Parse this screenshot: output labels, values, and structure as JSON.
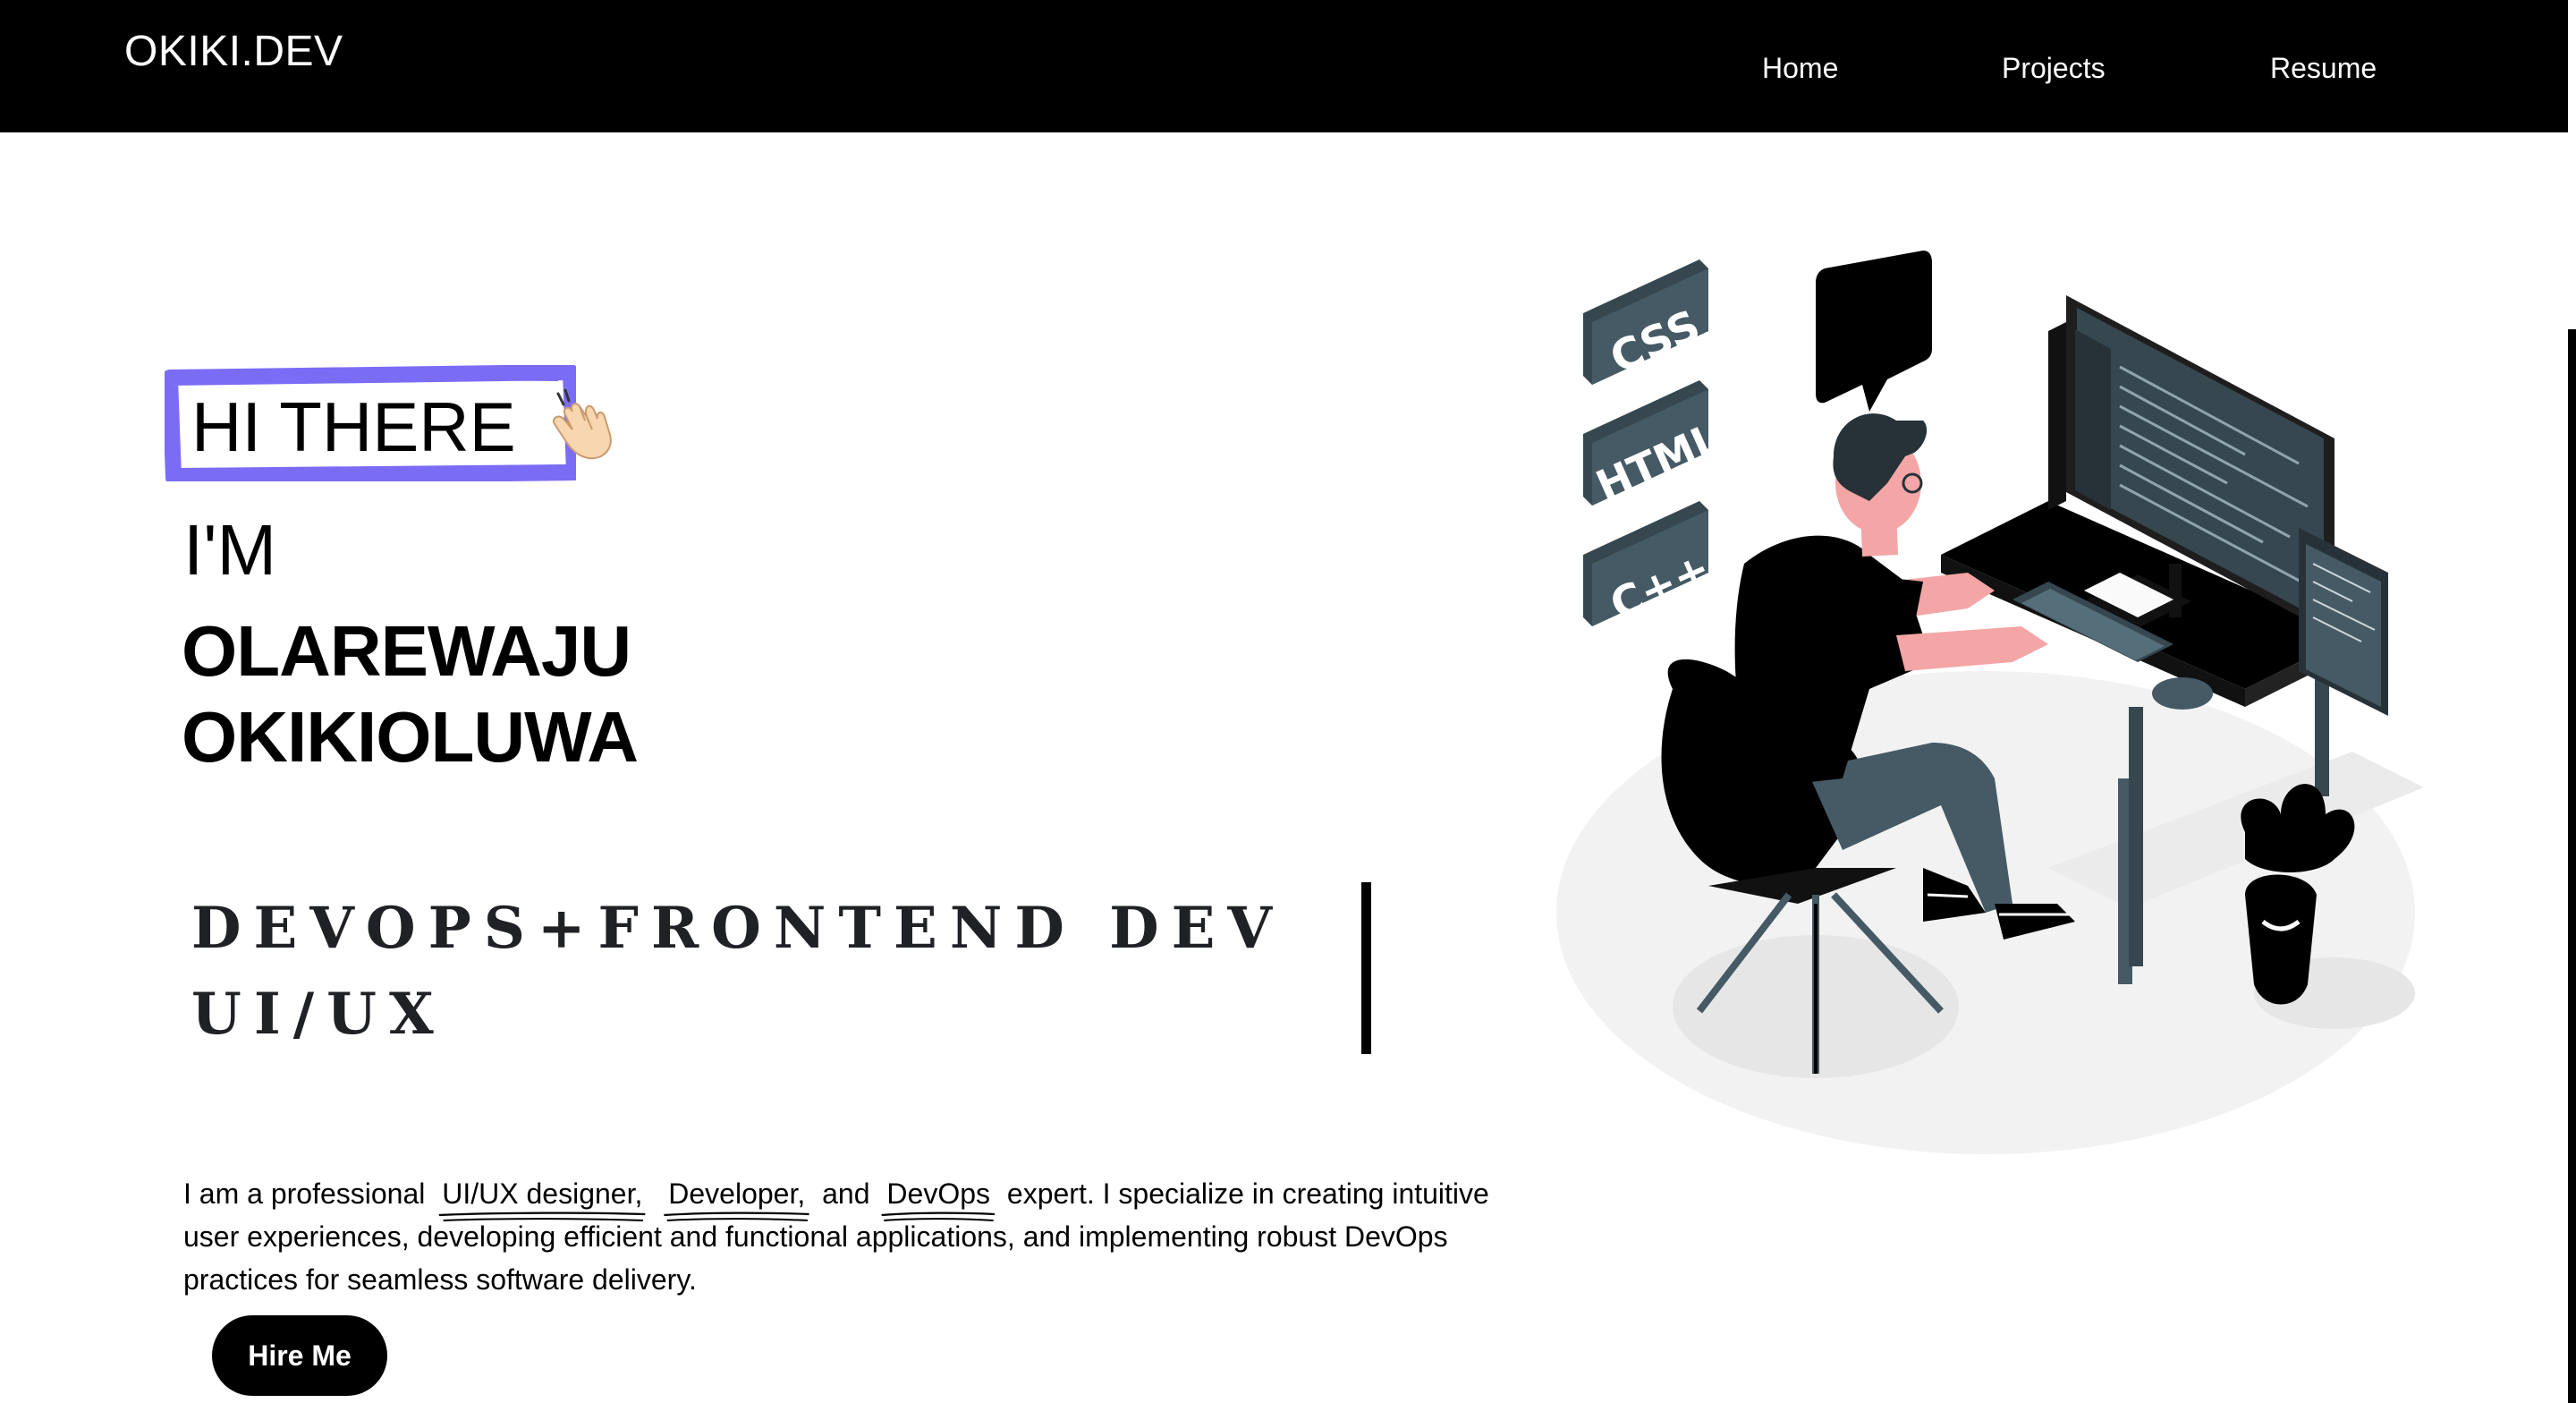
{
  "nav": {
    "brand": "OKIKI.DEV",
    "links": [
      {
        "label": "Home"
      },
      {
        "label": "Projects"
      },
      {
        "label": "Resume"
      }
    ]
  },
  "hero": {
    "greeting": "HI THERE",
    "greeting_icon": "waving-hand-icon",
    "im": "I'M",
    "name_line1": "OLAREWAJU",
    "name_line2": "OKIKIOLUWA",
    "roles": "DEVOPS+FRONTEND DEV\nUI/UX",
    "intro": {
      "prefix": "I am a professional",
      "highlight1": "UI/UX designer,",
      "highlight2": "Developer,",
      "and": "and",
      "highlight3": "DevOps",
      "suffix": "expert. I specialize in creating intuitive user experiences, developing efficient and functional applications, and implementing robust DevOps practices for seamless software delivery."
    },
    "cta": "Hire Me"
  },
  "illustration": {
    "icon": "developer-at-desk-illustration",
    "badges": [
      "CSS",
      "HTML",
      "C++"
    ]
  },
  "colors": {
    "nav_bg": "#000000",
    "accent": "#7b6cf6",
    "text": "#000000",
    "illustration_dark": "#37474f",
    "illustration_skin": "#f4a6a6"
  }
}
